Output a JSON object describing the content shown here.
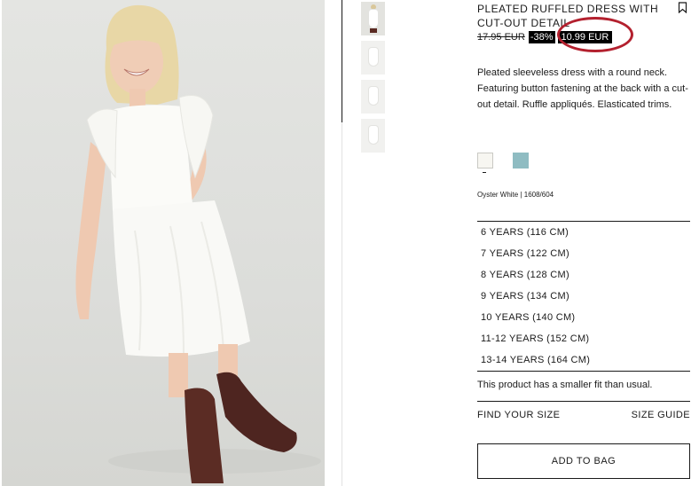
{
  "product": {
    "title": "PLEATED RUFFLED DRESS WITH CUT-OUT DETAIL",
    "old_price": "17.95 EUR",
    "discount": "-38%",
    "new_price": "10.99 EUR",
    "description": "Pleated sleeveless dress with a round neck. Featuring button fastening at the back with a cut-out detail. Ruffle appliqués. Elasticated trims.",
    "color_label": "Oyster White | 1608/604"
  },
  "colors": {
    "swatch_white": "#f7f6f1",
    "swatch_blue": "#8fbcc2",
    "highlight_circle": "#b3202e"
  },
  "sizes": [
    "6 YEARS (116 CM)",
    "7 YEARS (122 CM)",
    "8 YEARS (128 CM)",
    "9 YEARS (134 CM)",
    "10 YEARS (140 CM)",
    "11-12 YEARS (152 CM)",
    "13-14 YEARS (164 CM)"
  ],
  "fit_note": "This product has a smaller fit than usual.",
  "links": {
    "find_your_size": "FIND YOUR SIZE",
    "size_guide": "SIZE GUIDE"
  },
  "cta": {
    "add_to_bag": "ADD TO BAG"
  },
  "icons": {
    "bookmark": "bookmark-icon"
  }
}
